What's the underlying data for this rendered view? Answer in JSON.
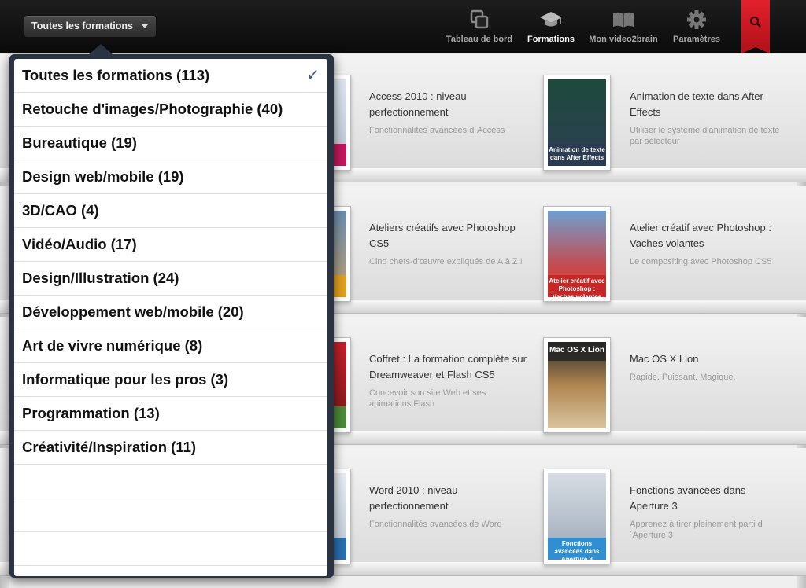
{
  "header": {
    "category_button": "Toutes les formations",
    "nav": [
      {
        "label": "Tableau de bord",
        "icon": "dashboard-icon"
      },
      {
        "label": "Formations",
        "icon": "graduation-cap-icon",
        "active": true
      },
      {
        "label": "Mon video2brain",
        "icon": "book-icon"
      },
      {
        "label": "Paramètres",
        "icon": "gear-icon"
      }
    ],
    "search_icon": "search-icon"
  },
  "categories": [
    {
      "label": "Toutes les formations (113)",
      "selected": true
    },
    {
      "label": "Retouche d'images/Photographie (40)"
    },
    {
      "label": "Bureautique (19)"
    },
    {
      "label": "Design web/mobile (19)"
    },
    {
      "label": "3D/CAO (4)"
    },
    {
      "label": "Vidéo/Audio (17)"
    },
    {
      "label": "Design/Illustration (24)"
    },
    {
      "label": "Développement web/mobile (20)"
    },
    {
      "label": "Art de vivre numérique (8)"
    },
    {
      "label": "Informatique pour les pros (3)"
    },
    {
      "label": "Programmation (13)"
    },
    {
      "label": "Créativité/Inspiration (11)"
    }
  ],
  "check_glyph": "✓",
  "courses": [
    {
      "title": "Access 2010 : niveau perfectionnement",
      "desc": "Fonctionnalités avancées d´Access"
    },
    {
      "title": "Animation de texte dans After Effects",
      "desc": "Utiliser le système d'animation de texte par sélecteur",
      "cover_caption": "Animation de texte dans After Effects"
    },
    {
      "title": "Ateliers créatifs avec Photoshop CS5",
      "desc": "Cinq chefs-d'œuvre expliqués de A à Z !"
    },
    {
      "title": "Atelier créatif avec Photoshop : Vaches volantes",
      "desc": "Le compositing avec Photoshop CS5",
      "cover_caption": "Atelier créatif avec Photoshop : Vaches volantes"
    },
    {
      "title": "Coffret : La formation complète sur Dreamweaver et Flash CS5",
      "desc": "Concevoir son site Web et ses animations Flash"
    },
    {
      "title": "Mac OS X Lion",
      "desc": "Rapide. Puissant. Magique.",
      "cover_caption": "Mac OS X Lion"
    },
    {
      "title": "Word 2010 : niveau perfectionnement",
      "desc": "Fonctionnalités avancées de Word"
    },
    {
      "title": "Fonctions avancées dans Aperture 3",
      "desc": "Apprenez à tirer pleinement parti d´Aperture 3",
      "cover_caption": "Fonctions avancées dans Aperture 3"
    }
  ]
}
